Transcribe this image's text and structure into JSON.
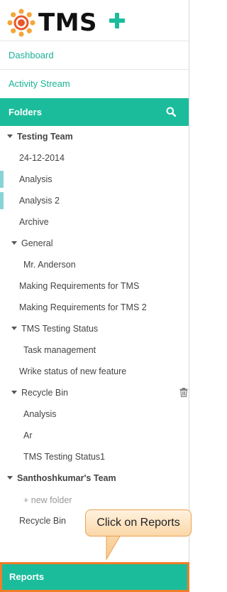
{
  "header": {
    "logo_text": "TMS",
    "add_icon": "plus-icon",
    "accent_color": "#1bbc9b"
  },
  "nav": {
    "dashboard": "Dashboard",
    "activity_stream": "Activity Stream"
  },
  "folders": {
    "title": "Folders",
    "search_icon": "search-icon"
  },
  "tree": {
    "testing_team": {
      "label": "Testing Team",
      "items": [
        "24-12-2014",
        "Analysis",
        "Analysis 2",
        "Archive"
      ],
      "general": {
        "label": "General",
        "items": [
          "Mr. Anderson"
        ]
      },
      "more_items": [
        "Making Requirements for TMS",
        "Making Requirements for TMS 2"
      ],
      "tms_testing_status": {
        "label": "TMS Testing Status",
        "items": [
          "Task management"
        ]
      },
      "wrike_item": "Wrike status of new feature",
      "recycle_bin": {
        "label": "Recycle Bin",
        "items": [
          "Analysis",
          "Ar",
          "TMS Testing Status1"
        ],
        "trash_icon": "trash-icon"
      }
    },
    "santhosh_team": {
      "label": "Santhoshkumar's Team",
      "new_folder": "+ new folder",
      "recycle_bin": "Recycle Bin"
    }
  },
  "callout": {
    "text": "Click on Reports",
    "border_color": "#e9a055"
  },
  "reports": {
    "label": "Reports",
    "highlight_color": "#f07e2a"
  }
}
